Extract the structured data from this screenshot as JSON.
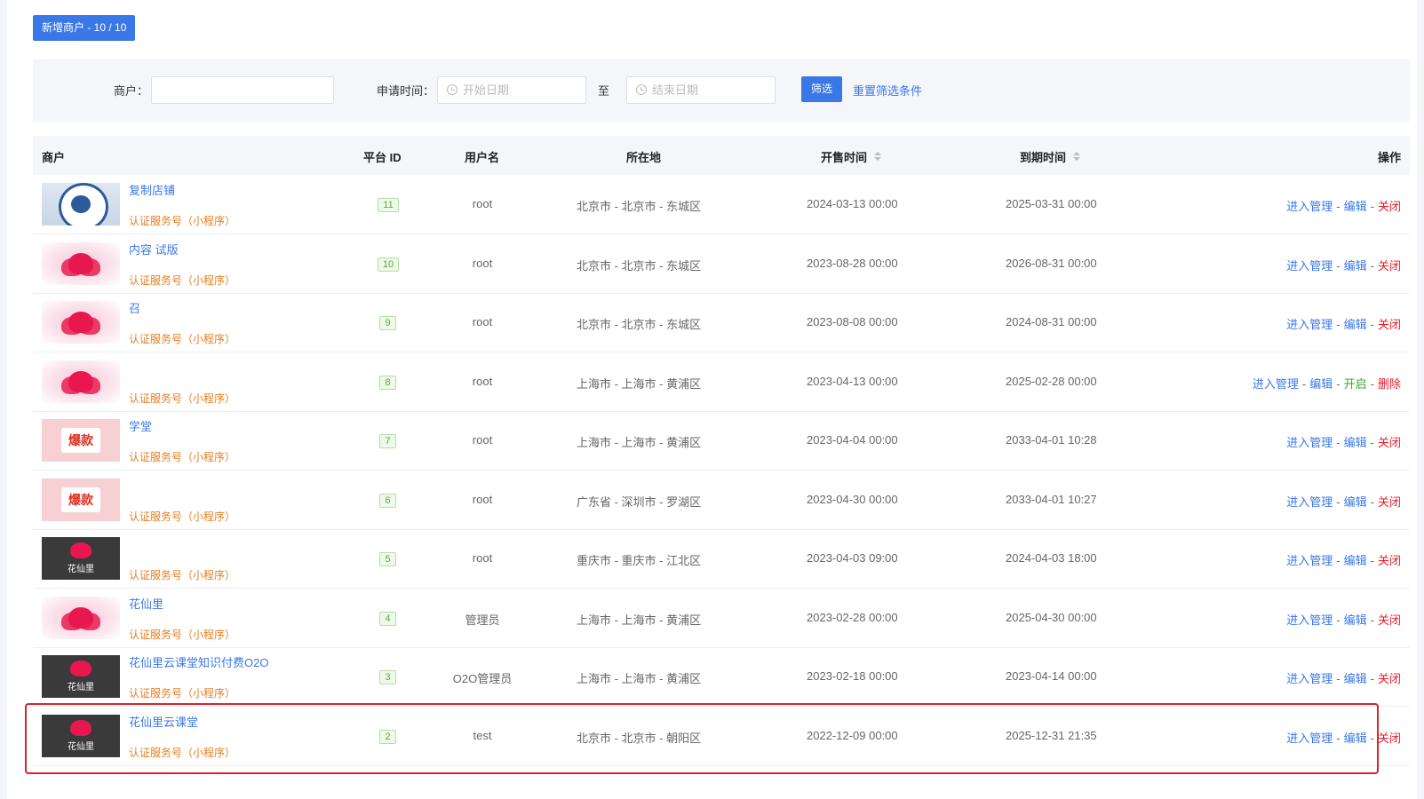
{
  "toolbar": {
    "add_label": "新增商户 - 10 / 10"
  },
  "filter": {
    "merchant_label": "商户：",
    "merchant_value": "",
    "time_label": "申请时间：",
    "start_placeholder": "开始日期",
    "to_label": "至",
    "end_placeholder": "结束日期",
    "filter_button": "筛选",
    "reset_link": "重置筛选条件"
  },
  "table": {
    "headers": {
      "merchant": "商户",
      "platform_id": "平台 ID",
      "username": "用户名",
      "location": "所在地",
      "open_time": "开售时间",
      "expire_time": "到期时间",
      "actions": "操作"
    },
    "rows": [
      {
        "thumb": "seal",
        "name": "复制店铺",
        "type": "认证服务号（小程序）",
        "id": "11",
        "user": "root",
        "loc": "北京市 - 北京市 - 东城区",
        "open": "2024-03-13 00:00",
        "expire": "2025-03-31 00:00",
        "ops": [
          "进入管理",
          "编辑",
          "关闭"
        ],
        "closed": false
      },
      {
        "thumb": "lotus",
        "name": "内容                    试版",
        "type": "认证服务号（小程序）",
        "id": "10",
        "user": "root",
        "loc": "北京市 - 北京市 - 东城区",
        "open": "2023-08-28 00:00",
        "expire": "2026-08-31 00:00",
        "ops": [
          "进入管理",
          "编辑",
          "关闭"
        ],
        "closed": false
      },
      {
        "thumb": "lotus",
        "name": "        召",
        "type": "认证服务号（小程序）",
        "id": "9",
        "user": "root",
        "loc": "北京市 - 北京市 - 东城区",
        "open": "2023-08-08 00:00",
        "expire": "2024-08-31 00:00",
        "ops": [
          "进入管理",
          "编辑",
          "关闭"
        ],
        "closed": false
      },
      {
        "thumb": "lotus",
        "name": "",
        "type": "认证服务号（小程序）",
        "id": "8",
        "user": "root",
        "loc": "上海市 - 上海市 - 黄浦区",
        "open": "2023-04-13 00:00",
        "expire": "2025-02-28 00:00",
        "ops": [
          "进入管理",
          "编辑",
          "开启",
          "删除"
        ],
        "closed": true
      },
      {
        "thumb": "baokuan",
        "name": "        学堂",
        "type": "认证服务号（小程序）",
        "id": "7",
        "user": "root",
        "loc": "上海市 - 上海市 - 黄浦区",
        "open": "2023-04-04 00:00",
        "expire": "2033-04-01 10:28",
        "ops": [
          "进入管理",
          "编辑",
          "关闭"
        ],
        "closed": false
      },
      {
        "thumb": "baokuan",
        "name": "",
        "type": "认证服务号（小程序）",
        "id": "6",
        "user": "root",
        "loc": "广东省 - 深圳市 - 罗湖区",
        "open": "2023-04-30 00:00",
        "expire": "2033-04-01 10:27",
        "ops": [
          "进入管理",
          "编辑",
          "关闭"
        ],
        "closed": false
      },
      {
        "thumb": "dark",
        "name": "",
        "type": "认证服务号（小程序）",
        "id": "5",
        "user": "root",
        "loc": "重庆市 - 重庆市 - 江北区",
        "open": "2023-04-03 09:00",
        "expire": "2024-04-03 18:00",
        "ops": [
          "进入管理",
          "编辑",
          "关闭"
        ],
        "closed": false
      },
      {
        "thumb": "lotus",
        "name": "花仙里",
        "type": "认证服务号（小程序）",
        "id": "4",
        "user": "管理员",
        "loc": "上海市 - 上海市 - 黄浦区",
        "open": "2023-02-28 00:00",
        "expire": "2025-04-30 00:00",
        "ops": [
          "进入管理",
          "编辑",
          "关闭"
        ],
        "closed": false
      },
      {
        "thumb": "dark",
        "name": "花仙里云课堂知识付费O2O",
        "type": "认证服务号（小程序）",
        "id": "3",
        "user": "O2O管理员",
        "loc": "上海市 - 上海市 - 黄浦区",
        "open": "2023-02-18 00:00",
        "expire": "2023-04-14 00:00",
        "ops": [
          "进入管理",
          "编辑",
          "关闭"
        ],
        "closed": false
      },
      {
        "thumb": "dark",
        "name": "花仙里云课堂",
        "type": "认证服务号（小程序）",
        "id": "2",
        "user": "test",
        "loc": "北京市 - 北京市 - 朝阳区",
        "open": "2022-12-09 00:00",
        "expire": "2025-12-31 21:35",
        "ops": [
          "进入管理",
          "编辑",
          "关闭"
        ],
        "closed": false
      }
    ]
  },
  "thumb_texts": {
    "baokuan": "爆款",
    "dark": "花仙里"
  }
}
